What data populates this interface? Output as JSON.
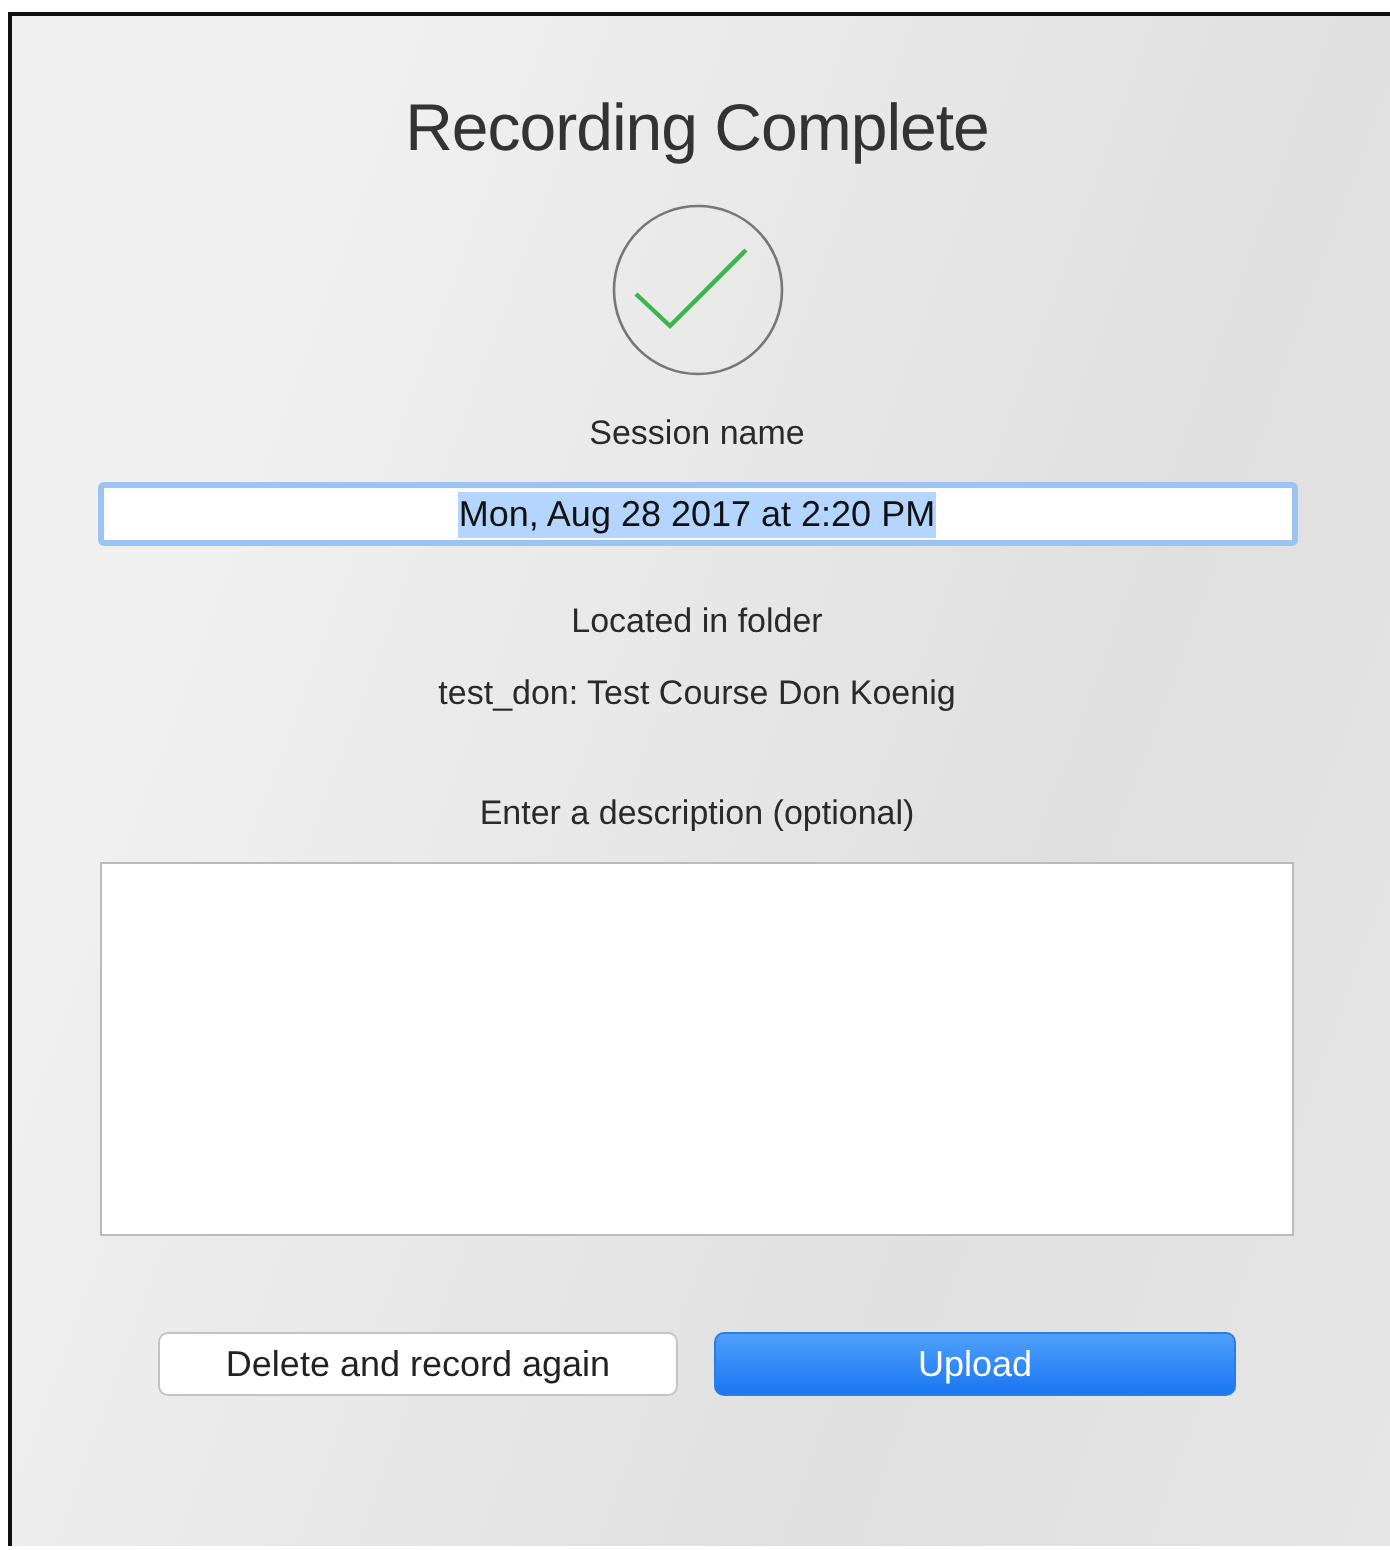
{
  "dialog": {
    "title": "Recording Complete",
    "session": {
      "label": "Session name",
      "value": "Mon, Aug 28 2017 at 2:20 PM",
      "selected": true
    },
    "folder": {
      "label": "Located in folder",
      "name": "test_don: Test Course Don Koenig"
    },
    "description": {
      "label": "Enter a description (optional)"
    },
    "buttons": [
      {
        "label": "Delete and record again",
        "kind": "default"
      },
      {
        "label": "Upload",
        "kind": "primary"
      }
    ]
  }
}
